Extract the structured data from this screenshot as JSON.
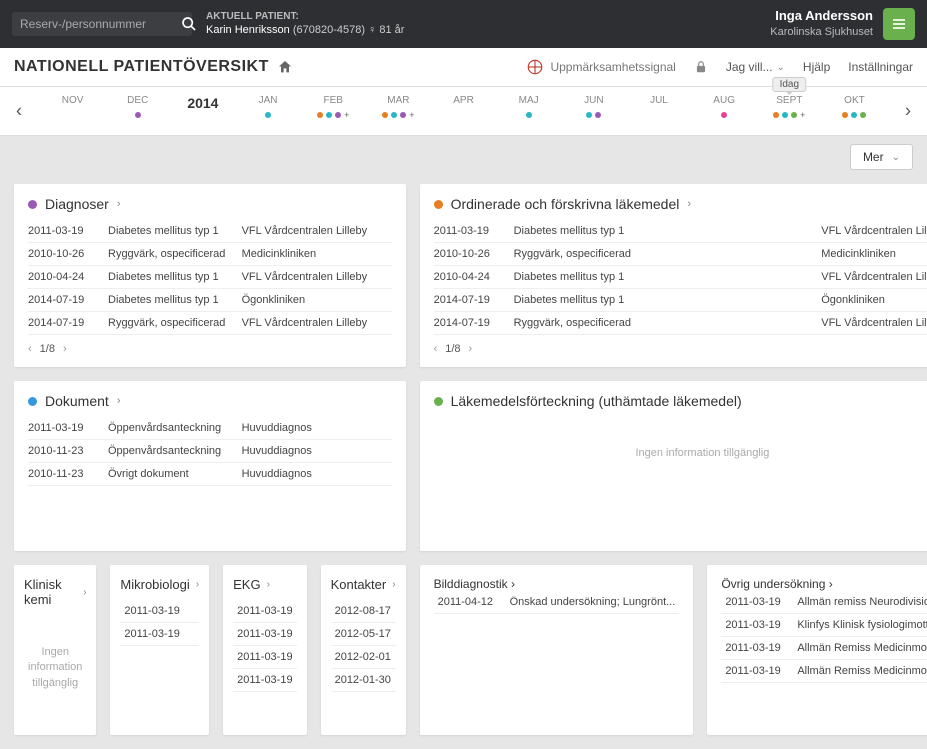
{
  "topbar": {
    "search_placeholder": "Reserv-/personnummer",
    "patient_label": "AKTUELL PATIENT:",
    "patient_name": "Karin Henriksson",
    "patient_id": "(670820-4578)",
    "patient_age": "81 år",
    "user_name": "Inga Andersson",
    "facility": "Karolinska Sjukhuset"
  },
  "subheader": {
    "title": "NATIONELL PATIENTÖVERSIKT",
    "attention": "Uppmärksamhetssignal",
    "jagvill": "Jag vill...",
    "help": "Hjälp",
    "settings": "Inställningar"
  },
  "timeline": {
    "today_label": "Idag",
    "months": [
      "NOV",
      "DEC",
      "2014",
      "JAN",
      "FEB",
      "MAR",
      "APR",
      "MAJ",
      "JUN",
      "JUL",
      "AUG",
      "SEPT",
      "OKT"
    ]
  },
  "mer_label": "Mer",
  "cards": {
    "diagnoser": {
      "title": "Diagnoser",
      "pager": "1/8",
      "rows": [
        {
          "d": "2011-03-19",
          "t": "Diabetes mellitus typ 1",
          "s": "VFL Vårdcentralen Lilleby"
        },
        {
          "d": "2010-10-26",
          "t": "Ryggvärk, ospecificerad",
          "s": "Medicinkliniken"
        },
        {
          "d": "2010-04-24",
          "t": "Diabetes mellitus typ 1",
          "s": "VFL Vårdcentralen Lilleby"
        },
        {
          "d": "2014-07-19",
          "t": "Diabetes mellitus typ 1",
          "s": "Ögonkliniken"
        },
        {
          "d": "2014-07-19",
          "t": "Ryggvärk, ospecificerad",
          "s": "VFL Vårdcentralen Lilleby"
        }
      ]
    },
    "ordinerade": {
      "title": "Ordinerade och förskrivna läkemedel",
      "pager": "1/8",
      "rows": [
        {
          "d": "2011-03-19",
          "t": "Diabetes mellitus typ 1",
          "s": "VFL Vårdcentralen Lilleby"
        },
        {
          "d": "2010-10-26",
          "t": "Ryggvärk, ospecificerad",
          "s": "Medicinkliniken"
        },
        {
          "d": "2010-04-24",
          "t": "Diabetes mellitus typ 1",
          "s": "VFL Vårdcentralen Lilleby"
        },
        {
          "d": "2014-07-19",
          "t": "Diabetes mellitus typ 1",
          "s": "Ögonkliniken"
        },
        {
          "d": "2014-07-19",
          "t": "Ryggvärk, ospecificerad",
          "s": "VFL Vårdcentralen Lilleby"
        }
      ]
    },
    "dokument": {
      "title": "Dokument",
      "rows": [
        {
          "d": "2011-03-19",
          "t": "Öppenvårdsanteckning",
          "s": "Huvuddiagnos"
        },
        {
          "d": "2010-11-23",
          "t": "Öppenvårdsanteckning",
          "s": "Huvuddiagnos"
        },
        {
          "d": "2010-11-23",
          "t": "Övrigt dokument",
          "s": "Huvuddiagnos"
        }
      ]
    },
    "lakemedel": {
      "title": "Läkemedelsförteckning (uthämtade läkemedel)",
      "empty": "Ingen information tillgänglig"
    }
  },
  "mini": {
    "klinisk": {
      "title": "Klinisk kemi",
      "empty": "Ingen information tillgänglig"
    },
    "mikro": {
      "title": "Mikrobiologi",
      "rows": [
        "2011-03-19",
        "2011-03-19"
      ]
    },
    "ekg": {
      "title": "EKG",
      "rows": [
        "2011-03-19",
        "2011-03-19",
        "2011-03-19",
        "2011-03-19"
      ]
    },
    "kontakter": {
      "title": "Kontakter",
      "rows": [
        "2012-08-17",
        "2012-05-17",
        "2012-02-01",
        "2012-01-30"
      ]
    },
    "bild": {
      "title": "Bilddiagnostik",
      "rows": [
        {
          "d": "2011-04-12",
          "t": "Önskad undersökning; Lungrönt..."
        }
      ]
    },
    "ovrig": {
      "title": "Övrig undersökning",
      "rows": [
        {
          "d": "2011-03-19",
          "t": "Allmän remiss Neurodivisionen..."
        },
        {
          "d": "2011-03-19",
          "t": "Klinfys Klinisk fysiologimott KSK..."
        },
        {
          "d": "2011-03-19",
          "t": "Allmän Remiss Medicinmott KSK..."
        },
        {
          "d": "2011-03-19",
          "t": "Allmän Remiss Medicinmott KSK..."
        }
      ]
    }
  }
}
